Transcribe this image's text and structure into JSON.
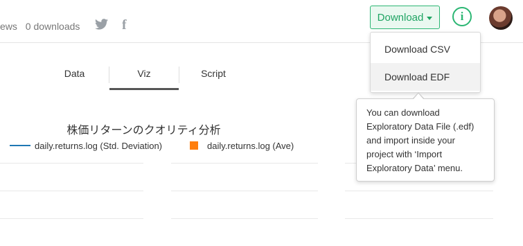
{
  "header": {
    "views_text": "ews",
    "downloads_text": "0 downloads",
    "twitter_icon": "twitter-icon",
    "facebook_icon": "facebook-icon",
    "download_button_label": "Download",
    "info_icon": "info-icon",
    "info_glyph": "i"
  },
  "download_menu": {
    "items": [
      {
        "label": "Download CSV"
      },
      {
        "label": "Download EDF"
      }
    ]
  },
  "tooltip": {
    "text": "You can download Exploratory Data File (.edf) and import inside your project with ‘Import Exploratory Data’ menu."
  },
  "tabs": [
    {
      "label": "Data"
    },
    {
      "label": "Viz",
      "active": true
    },
    {
      "label": "Script"
    }
  ],
  "chart": {
    "title": "株価リターンのクオリティ分析",
    "legend": [
      {
        "label": "daily.returns.log (Std. Deviation)",
        "color": "#1f77b4",
        "shape": "line"
      },
      {
        "label": "daily.returns.log (Ave)",
        "color": "#ff7f0e",
        "shape": "square"
      }
    ]
  },
  "colors": {
    "accent": "#2bb673",
    "accent_bg": "#eaf8f0"
  }
}
